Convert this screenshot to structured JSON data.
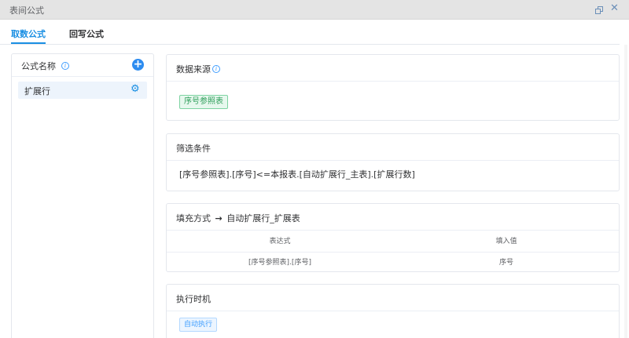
{
  "window": {
    "title": "表间公式"
  },
  "tabs": [
    {
      "label": "取数公式",
      "active": true
    },
    {
      "label": "回写公式",
      "active": false
    }
  ],
  "sidebar": {
    "header_label": "公式名称",
    "items": [
      {
        "label": "扩展行"
      }
    ]
  },
  "data_source": {
    "title": "数据来源",
    "tag": "序号参照表"
  },
  "filter": {
    "title": "筛选条件",
    "expression": "[序号参照表].[序号]<=本报表.[自动扩展行_主表].[扩展行数]"
  },
  "fill": {
    "title": "填充方式",
    "arrow": "→",
    "target": "自动扩展行_扩展表",
    "columns": [
      "表达式",
      "填入值"
    ],
    "rows": [
      {
        "expression": "[序号参照表].[序号]",
        "value": "序号"
      }
    ]
  },
  "exec": {
    "title": "执行时机",
    "tag": "自动执行"
  },
  "colors": {
    "accent": "#1a8fe3",
    "green_tag": "#2f9e5b",
    "blue_tag": "#409eff"
  },
  "icons": {
    "info": "info-icon",
    "add": "plus-circle-icon",
    "settings": "gear-icon",
    "restore": "restore-window-icon",
    "close": "close-icon"
  }
}
